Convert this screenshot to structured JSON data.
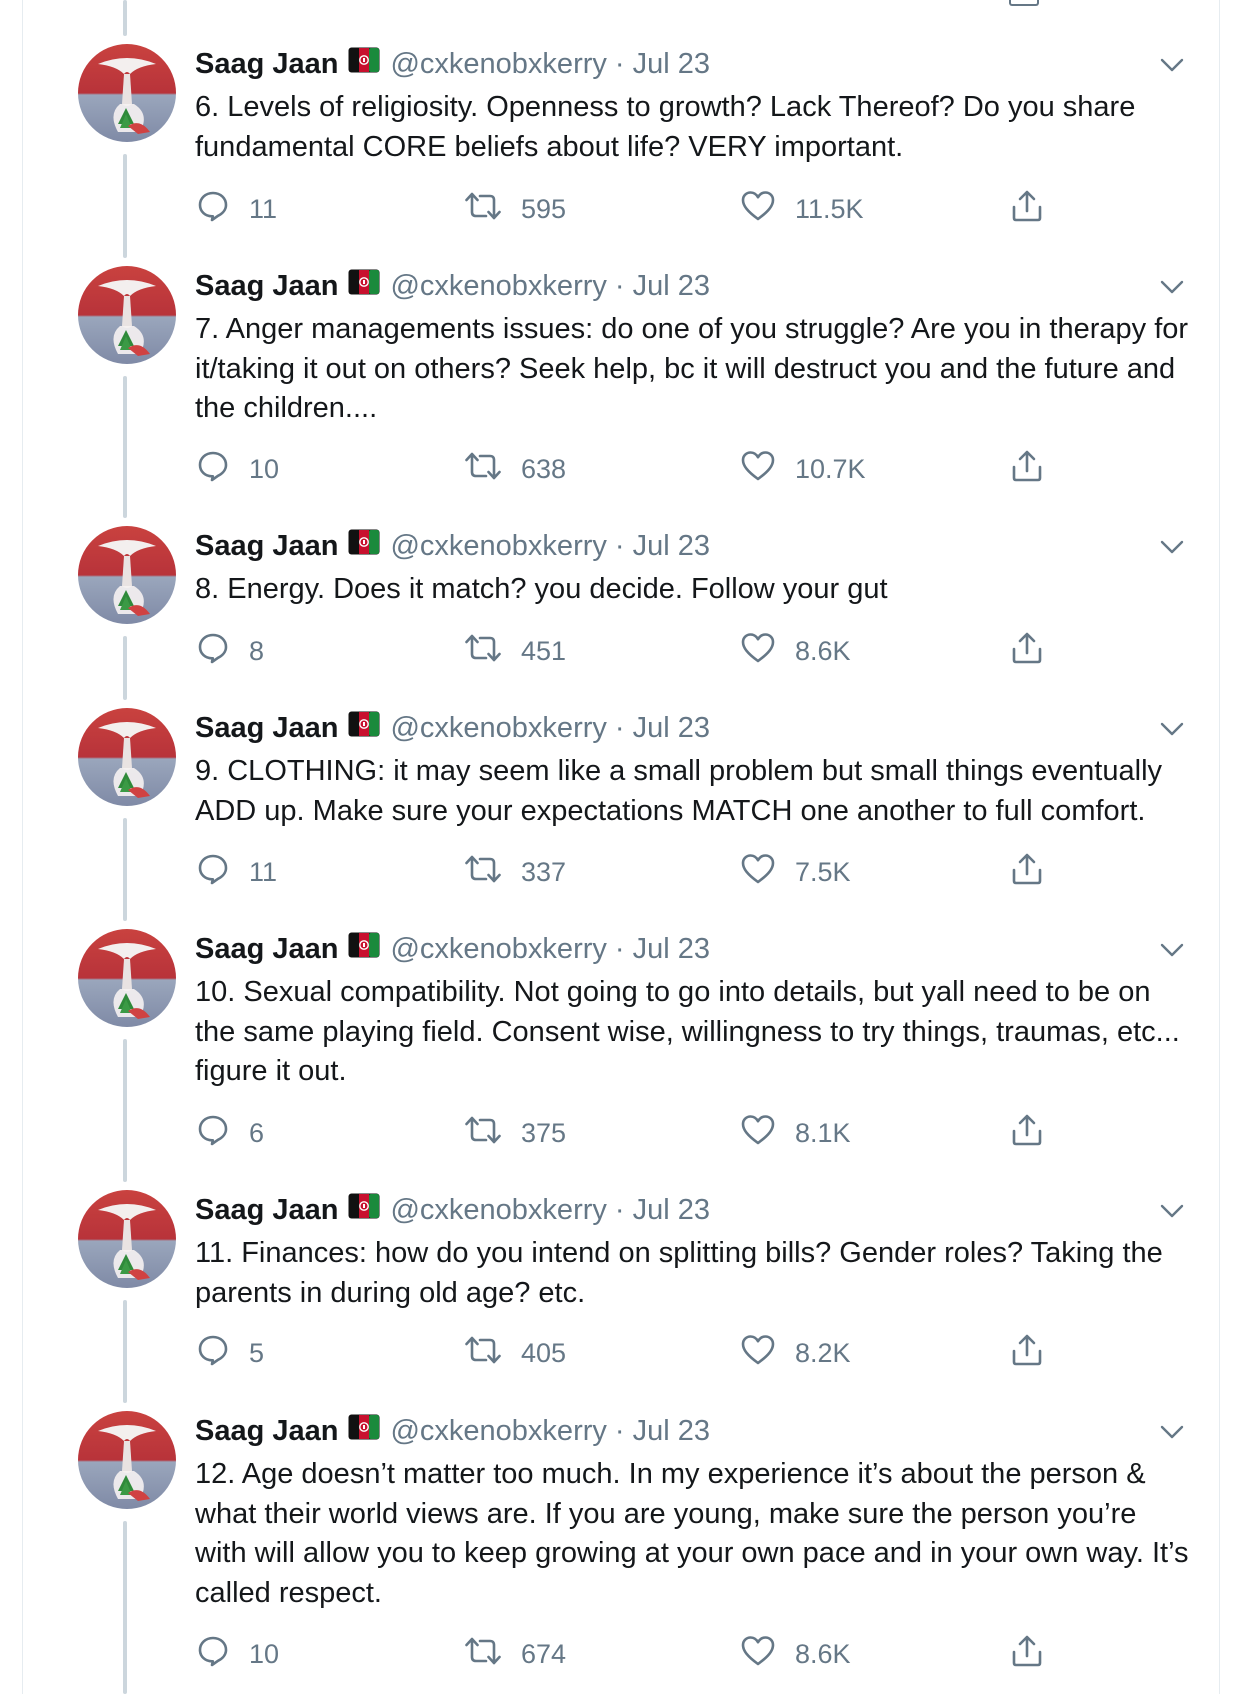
{
  "colors": {
    "text": "#14171a",
    "muted": "#657786",
    "line": "#ccd6dd",
    "border": "#e6ecf0"
  },
  "icons": {
    "reply": "comment-bubble-icon",
    "retweet": "retweet-arrows-icon",
    "like": "heart-icon",
    "share": "share-upload-icon",
    "caret": "chevron-down-icon",
    "flag": "afghanistan-flag-icon"
  },
  "tweets": [
    {
      "name": "Saag Jaan",
      "handle": "@cxkenobxkerry",
      "dot": "·",
      "date": "Jul 23",
      "text": "6. Levels of religiosity. Openness to growth? Lack Thereof? Do you share fundamental CORE beliefs about life? VERY important.",
      "replies": "11",
      "retweets": "595",
      "likes": "11.5K"
    },
    {
      "name": "Saag Jaan",
      "handle": "@cxkenobxkerry",
      "dot": "·",
      "date": "Jul 23",
      "text": "7. Anger managements issues: do one of you struggle? Are you in therapy for it/taking it out on others? Seek help, bc it will destruct you and the future and the children....",
      "replies": "10",
      "retweets": "638",
      "likes": "10.7K"
    },
    {
      "name": "Saag Jaan",
      "handle": "@cxkenobxkerry",
      "dot": "·",
      "date": "Jul 23",
      "text": "8. Energy. Does it match? you decide. Follow your gut",
      "replies": "8",
      "retweets": "451",
      "likes": "8.6K"
    },
    {
      "name": "Saag Jaan",
      "handle": "@cxkenobxkerry",
      "dot": "·",
      "date": "Jul 23",
      "text": "9. CLOTHING: it may seem like a small problem but small things eventually ADD up. Make sure your expectations MATCH one another to full comfort.",
      "replies": "11",
      "retweets": "337",
      "likes": "7.5K"
    },
    {
      "name": "Saag Jaan",
      "handle": "@cxkenobxkerry",
      "dot": "·",
      "date": "Jul 23",
      "text": "10. Sexual compatibility. Not going to go into details, but yall need to be on the same playing field. Consent wise, willingness to try things, traumas, etc... figure it out.",
      "replies": "6",
      "retweets": "375",
      "likes": "8.1K"
    },
    {
      "name": "Saag Jaan",
      "handle": "@cxkenobxkerry",
      "dot": "·",
      "date": "Jul 23",
      "text": "11. Finances: how do you intend on splitting bills? Gender roles? Taking the parents in during old age? etc.",
      "replies": "5",
      "retweets": "405",
      "likes": "8.2K"
    },
    {
      "name": "Saag Jaan",
      "handle": "@cxkenobxkerry",
      "dot": "·",
      "date": "Jul 23",
      "text": "12. Age doesn’t matter too much. In my experience it’s about the person & what their world views are. If you are young, make sure the person you’re with will allow you to keep growing at your own pace and in your own way. It’s called respect.",
      "replies": "10",
      "retweets": "674",
      "likes": "8.6K"
    }
  ]
}
